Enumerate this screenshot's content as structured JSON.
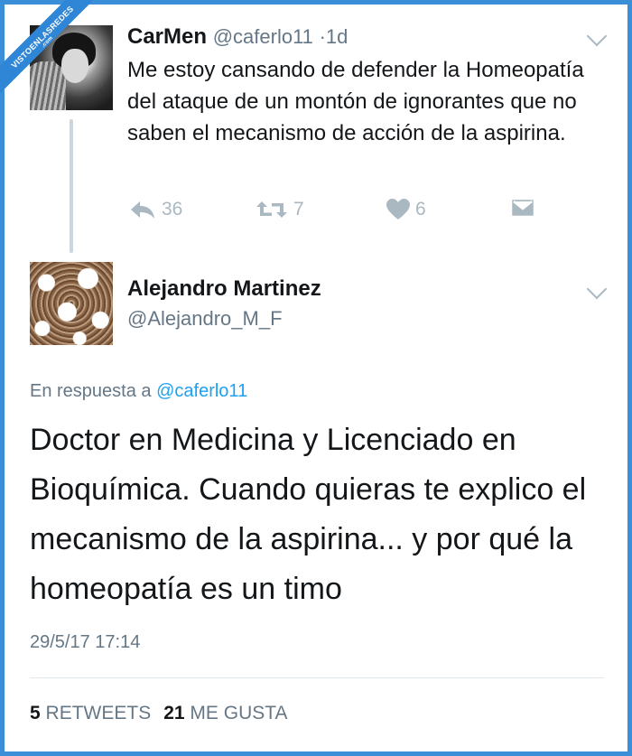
{
  "watermark": {
    "line1": "VISTOENLASREDES",
    "line2": ".com"
  },
  "tweet1": {
    "name": "CarMen",
    "handle": "@caferlo11",
    "separator": "·",
    "time": "1d",
    "text": "Me estoy cansando de defender la Homeopatía del ataque de un montón de ignorantes que no saben el mecanismo de acción de la aspirina.",
    "reply_count": "36",
    "retweet_count": "7",
    "like_count": "6",
    "icons": [
      "reply-icon",
      "retweet-icon",
      "heart-icon",
      "message-icon",
      "chevron-down-icon"
    ]
  },
  "tweet2": {
    "name": "Alejandro Martinez",
    "handle": "@Alejandro_M_F",
    "reply_prefix": "En respuesta a",
    "reply_mention": "@caferlo11",
    "text": "Doctor en Medicina y Licenciado en Bioquímica. Cuando quieras te explico el mecanismo de la aspirina... y por qué la homeopatía es un timo",
    "timestamp": "29/5/17 17:14",
    "retweets_count": "5",
    "retweets_label": "RETWEETS",
    "likes_count": "21",
    "likes_label": "ME GUSTA"
  },
  "colors": {
    "frame": "#3a8fd8",
    "text": "#14171a",
    "muted": "#657786",
    "icon": "#aab8c2",
    "link": "#1da1f2"
  }
}
